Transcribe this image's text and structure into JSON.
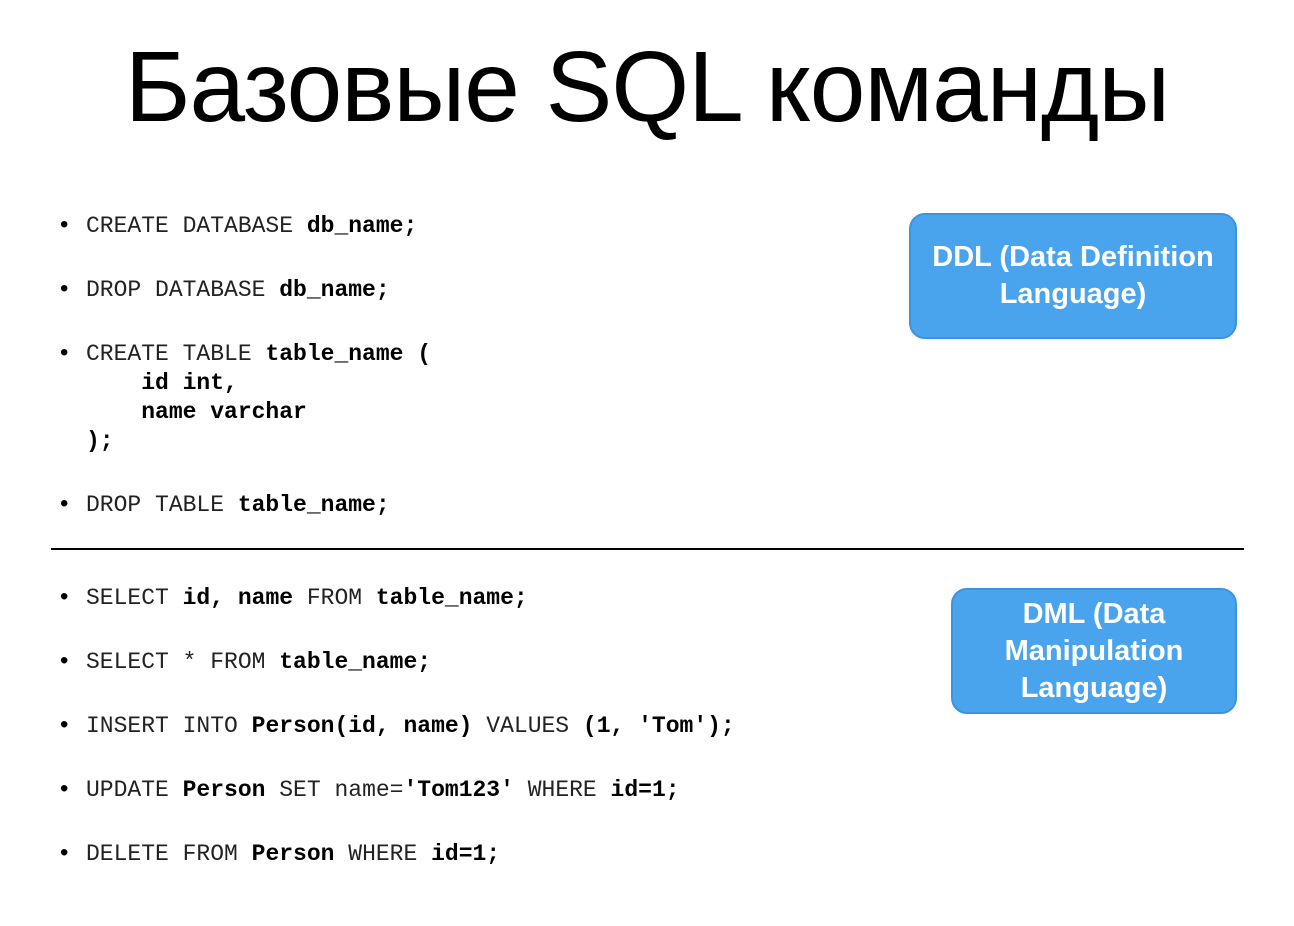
{
  "title": "Базовые SQL команды",
  "ddl": {
    "label": "DDL (Data Definition Language)",
    "items": [
      {
        "parts": [
          {
            "t": "CREATE DATABASE ",
            "s": "kw"
          },
          {
            "t": "db_name;",
            "s": "b"
          }
        ]
      },
      {
        "parts": [
          {
            "t": "DROP DATABASE ",
            "s": "kw"
          },
          {
            "t": "db_name;",
            "s": "b"
          }
        ]
      },
      {
        "parts": [
          {
            "t": "CREATE TABLE ",
            "s": "kw"
          },
          {
            "t": "table_name (",
            "s": "b"
          }
        ],
        "continuation": [
          [
            {
              "t": "    id int,",
              "s": "b"
            }
          ],
          [
            {
              "t": "    name varchar",
              "s": "b"
            }
          ],
          [
            {
              "t": ");",
              "s": "b"
            }
          ]
        ]
      },
      {
        "parts": [
          {
            "t": "DROP TABLE ",
            "s": "kw"
          },
          {
            "t": "table_name;",
            "s": "b"
          }
        ]
      }
    ]
  },
  "dml": {
    "label": "DML (Data Manipulation Language)",
    "items": [
      {
        "parts": [
          {
            "t": "SELECT ",
            "s": "kw"
          },
          {
            "t": "id, name",
            "s": "b"
          },
          {
            "t": " FROM ",
            "s": "kw"
          },
          {
            "t": "table_name;",
            "s": "b"
          }
        ]
      },
      {
        "parts": [
          {
            "t": "SELECT * FROM ",
            "s": "kw"
          },
          {
            "t": "table_name;",
            "s": "b"
          }
        ]
      },
      {
        "parts": [
          {
            "t": "INSERT INTO ",
            "s": "kw"
          },
          {
            "t": "Person(id, name)",
            "s": "b"
          },
          {
            "t": " VALUES ",
            "s": "kw"
          },
          {
            "t": "(1, 'Tom');",
            "s": "b"
          }
        ]
      },
      {
        "parts": [
          {
            "t": "UPDATE ",
            "s": "kw"
          },
          {
            "t": "Person",
            "s": "b"
          },
          {
            "t": " SET name=",
            "s": "kw"
          },
          {
            "t": "'Tom123'",
            "s": "b"
          },
          {
            "t": " WHERE ",
            "s": "kw"
          },
          {
            "t": "id=1;",
            "s": "b"
          }
        ]
      },
      {
        "parts": [
          {
            "t": "DELETE FROM ",
            "s": "kw"
          },
          {
            "t": "Person",
            "s": "b"
          },
          {
            "t": " WHERE ",
            "s": "kw"
          },
          {
            "t": "id=1;",
            "s": "b"
          }
        ]
      }
    ]
  },
  "colors": {
    "tag_background": "#4aa3ed",
    "tag_text": "#ffffff"
  }
}
